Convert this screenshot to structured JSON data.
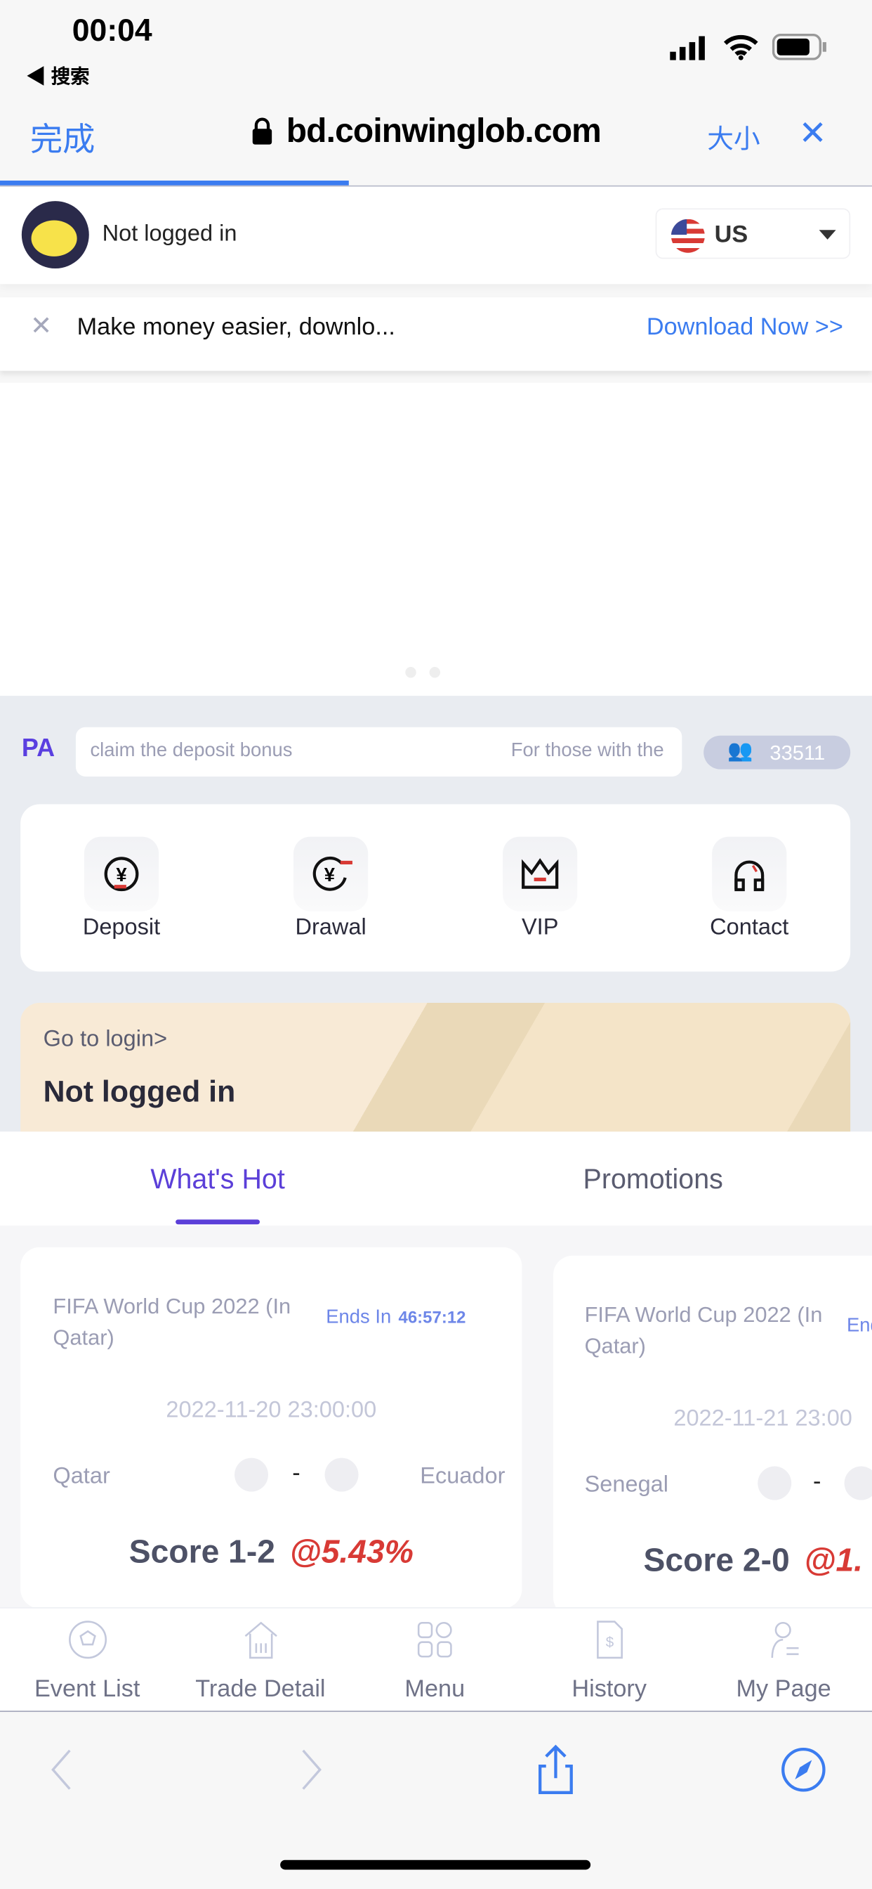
{
  "status_bar": {
    "time": "00:04",
    "back_label": "◀ 搜索"
  },
  "browser": {
    "done": "完成",
    "url": "bd.coinwinglob.com",
    "text_size": "大小",
    "close": "✕",
    "load_progress": 0.4
  },
  "header": {
    "user_status": "Not logged in",
    "region": "US"
  },
  "banner": {
    "text": "Make money easier, downlo...",
    "link": "Download Now >>"
  },
  "notice": {
    "label": "PA",
    "marquee_left": "claim the deposit bonus",
    "marquee_right": "For those with the",
    "online_count": "33511"
  },
  "quick_actions": [
    {
      "label": "Deposit",
      "icon": "deposit-icon"
    },
    {
      "label": "Drawal",
      "icon": "withdraw-icon"
    },
    {
      "label": "VIP",
      "icon": "crown-icon"
    },
    {
      "label": "Contact",
      "icon": "headset-icon"
    }
  ],
  "login_card": {
    "link": "Go to login>",
    "title": "Not logged in"
  },
  "tabs": [
    {
      "label": "What's Hot",
      "active": true
    },
    {
      "label": "Promotions",
      "active": false
    }
  ],
  "matches": [
    {
      "title": "FIFA World Cup 2022 (In Qatar)",
      "ends_label": "Ends In",
      "countdown": "46:57:12",
      "datetime": "2022-11-20 23:00:00",
      "home": "Qatar",
      "away": "Ecuador",
      "score": "Score 1-2",
      "odds": "@5.43%"
    },
    {
      "title": "FIFA World Cup 2022 (In Qatar)",
      "ends_label": "End",
      "datetime": "2022-11-21 23:00",
      "home": "Senegal",
      "away": "",
      "score": "Score 2-0",
      "odds": "@1."
    }
  ],
  "bottom_nav": [
    {
      "label": "Event List",
      "icon": "soccer-ball-icon"
    },
    {
      "label": "Trade Detail",
      "icon": "chart-house-icon"
    },
    {
      "label": "Menu",
      "icon": "grid-icon"
    },
    {
      "label": "History",
      "icon": "bill-icon"
    },
    {
      "label": "My Page",
      "icon": "user-icon"
    }
  ],
  "colors": {
    "accent": "#5b3fd8",
    "browser_blue": "#3b7cf0",
    "odds_red": "#d83a35"
  }
}
